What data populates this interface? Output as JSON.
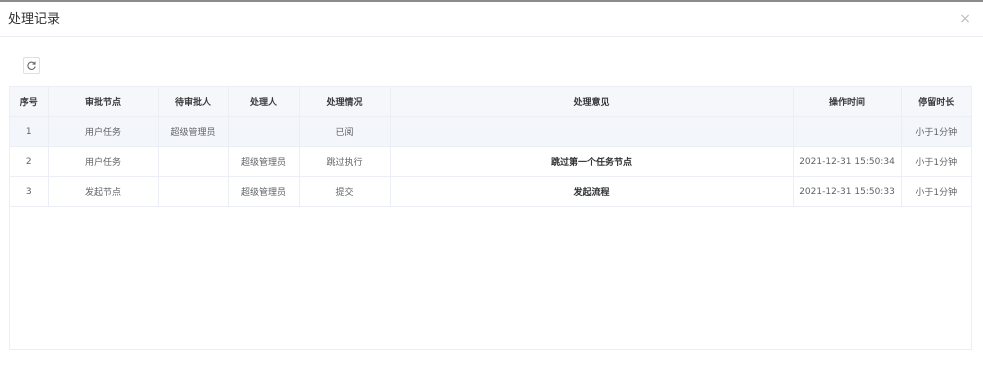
{
  "dialog": {
    "title": "处理记录",
    "close": "×"
  },
  "table": {
    "headers": [
      "序号",
      "审批节点",
      "待审批人",
      "处理人",
      "处理情况",
      "处理意见",
      "操作时间",
      "停留时长"
    ],
    "rows": [
      {
        "index": "1",
        "node": "用户任务",
        "pending": "超级管理员",
        "handler": "",
        "status": "已阅",
        "opinion": "",
        "time": "",
        "duration": "小于1分钟"
      },
      {
        "index": "2",
        "node": "用户任务",
        "pending": "",
        "handler": "超级管理员",
        "status": "跳过执行",
        "opinion": "跳过第一个任务节点",
        "time": "2021-12-31 15:50:34",
        "duration": "小于1分钟"
      },
      {
        "index": "3",
        "node": "发起节点",
        "pending": "",
        "handler": "超级管理员",
        "status": "提交",
        "opinion": "发起流程",
        "time": "2021-12-31 15:50:33",
        "duration": "小于1分钟"
      }
    ]
  }
}
